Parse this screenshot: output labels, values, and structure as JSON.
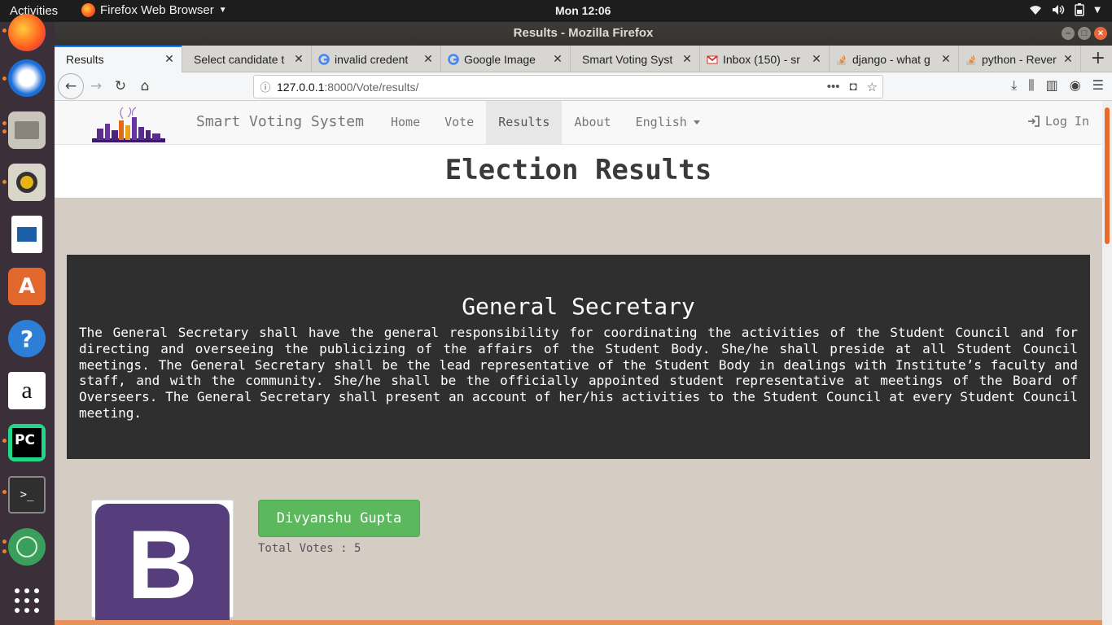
{
  "topbar": {
    "activities": "Activities",
    "app_menu": "Firefox Web Browser",
    "clock": "Mon 12:06"
  },
  "window": {
    "title": "Results - Mozilla Firefox"
  },
  "tabs": [
    {
      "label": "Results",
      "icon": "none"
    },
    {
      "label": "Select candidate t",
      "icon": "none"
    },
    {
      "label": "invalid credent",
      "icon": "google-icon"
    },
    {
      "label": "Google Image",
      "icon": "google-icon"
    },
    {
      "label": "Smart Voting Syst",
      "icon": "none"
    },
    {
      "label": "Inbox (150) - sr",
      "icon": "gmail-icon"
    },
    {
      "label": "django - what g",
      "icon": "stackoverflow-icon"
    },
    {
      "label": "python - Rever",
      "icon": "stackoverflow-icon"
    }
  ],
  "urlbar": {
    "host": "127.0.0.1",
    "path": ":8000/Vote/results/"
  },
  "site": {
    "brand": "Smart Voting System",
    "nav": {
      "home": "Home",
      "vote": "Vote",
      "results": "Results",
      "about": "About",
      "language": "English"
    },
    "login": "Log In"
  },
  "page": {
    "heading": "Election Results",
    "post": {
      "title": "General Secretary",
      "description": "The General Secretary shall have the general responsibility for coordinating the activities of the Student Council and for directing and overseeing the publicizing of the affairs of the Student Body. She/he shall preside at all Student Council meetings. The General Secretary shall be the lead representative of the Student Body in dealings with Institute’s faculty and staff, and with the community. She/he shall be the officially appointed student representative at meetings of the Board of Overseers. The General Secretary shall present an account of her/his activities to the Student Council at every Student Council meeting."
    },
    "candidate": {
      "name": "Divyanshu Gupta",
      "votes_label": "Total Votes : 5",
      "image_letter": "B"
    }
  },
  "colors": {
    "dock": "#3b2f3a",
    "accent_orange": "#e86b2a",
    "candidate_button": "#5cb85c",
    "post_box": "#2f2f2f",
    "page_bg": "#d5ccc3"
  }
}
